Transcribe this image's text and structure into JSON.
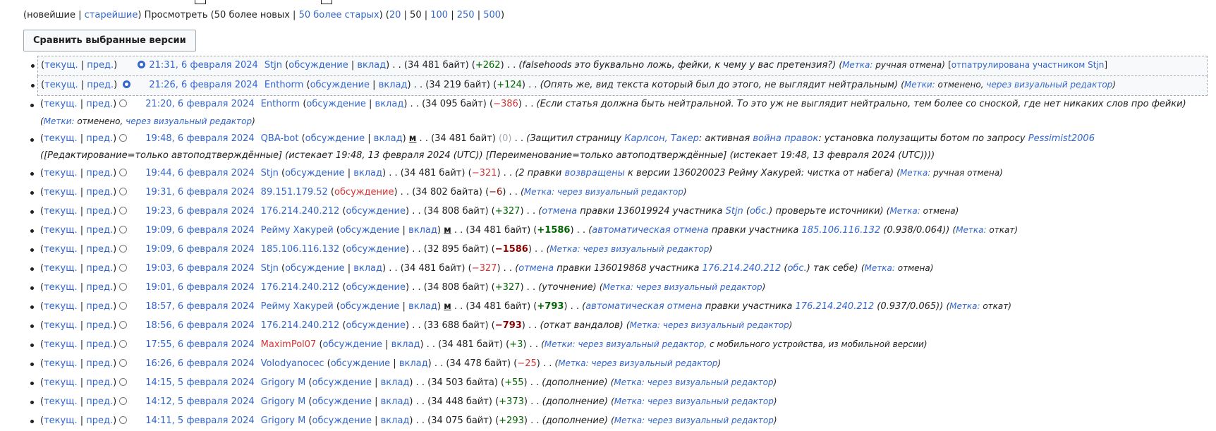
{
  "nav": {
    "newest": "новейшие",
    "oldest": "старейшие",
    "view": "Просмотреть",
    "newer50": "50 более новых",
    "older50": "50 более старых",
    "limits": [
      "20",
      "50",
      "100",
      "250",
      "500"
    ]
  },
  "compare_button": "Сравнить выбранные версии",
  "labels": {
    "cur": "текущ.",
    "prev": "пред.",
    "talk": "обсуждение",
    "contribs": "вклад",
    "talk_short": "обс.",
    "tag": "Метка:",
    "tags": "Метки:",
    "minor": "м",
    "patrolled_by": "отпатрулирована участником"
  },
  "revisions": [
    {
      "date": "21:31, 6 февраля 2024",
      "user": "Stjn",
      "size": "(34 481 байт)",
      "diff": "+262",
      "comment": "falsehoods это буквально ложь, фейки, к чему у вас претензия?",
      "tag": "ручная отмена",
      "patrolled": "Stjn"
    },
    {
      "date": "21:26, 6 февраля 2024",
      "user": "Enthorm",
      "size": "(34 219 байт)",
      "diff": "+124",
      "comment": "Опять же, вид текста который был до этого, не выглядит нейтральным",
      "tag1": "отменено,",
      "tag2": "через визуальный редактор"
    },
    {
      "date": "21:20, 6 февраля 2024",
      "user": "Enthorm",
      "size": "(34 095 байт)",
      "diff": "−386",
      "comment": "Если статья должна быть нейтральной. То это уж не выглядит нейтрально, тем более со сноской, где нет никаких слов про фейки",
      "tag1": "отменено,",
      "tag2": "через визуальный редактор"
    },
    {
      "date": "19:48, 6 февраля 2024",
      "user": "QBA-bot",
      "size": "(34 481 байт)",
      "diff": "0",
      "c1": "Защитил страницу",
      "l1": "Карлсон, Такер",
      "c2": ": активная",
      "l2": "война правок",
      "c3": ": установка полузащиты ботом по запросу",
      "l3": "Pessimist2006",
      "c4": "([Редактирование=только автоподтверждённые] (истекает 19:48, 13 февраля 2024 (UTC)) [Переименование=только автоподтверждённые] (истекает 19:48, 13 февраля 2024 (UTC)))"
    },
    {
      "date": "19:44, 6 февраля 2024",
      "user": "Stjn",
      "size": "(34 481 байт)",
      "diff": "−321",
      "c1": "(2 правки",
      "l1": "возвращены",
      "c2": "к версии 136020023 Рейму Хакурей: чистка от набега)",
      "tag": "ручная отмена"
    },
    {
      "date": "19:31, 6 февраля 2024",
      "user": "89.151.179.52",
      "size": "(34 802 байта)",
      "diff": "−6",
      "tag": "через визуальный редактор"
    },
    {
      "date": "19:23, 6 февраля 2024",
      "user": "176.214.240.212",
      "size": "(34 808 байт)",
      "diff": "+327",
      "l1": "отмена",
      "c1": "правки 136019924 участника",
      "l2": "Stjn",
      "c2": "проверьте источники)",
      "tag": "отмена"
    },
    {
      "date": "19:09, 6 февраля 2024",
      "user": "Рейму Хакурей",
      "size": "(34 481 байт)",
      "diff": "+1586",
      "l1": "автоматическая отмена",
      "c1": "правки участника",
      "l2": "185.106.116.132",
      "c2": "(0.938/0.064))",
      "tag": "откат"
    },
    {
      "date": "19:09, 6 февраля 2024",
      "user": "185.106.116.132",
      "size": "(32 895 байт)",
      "diff": "−1586",
      "tag": "через визуальный редактор"
    },
    {
      "date": "19:03, 6 февраля 2024",
      "user": "Stjn",
      "size": "(34 481 байт)",
      "diff": "−327",
      "l1": "отмена",
      "c1": "правки 136019868 участника",
      "l2": "176.214.240.212",
      "c2": "так себе)",
      "tag": "отмена"
    },
    {
      "date": "19:01, 6 февраля 2024",
      "user": "176.214.240.212",
      "size": "(34 808 байт)",
      "diff": "+327",
      "comment": "уточнение",
      "tag": "через визуальный редактор"
    },
    {
      "date": "18:57, 6 февраля 2024",
      "user": "Рейму Хакурей",
      "size": "(34 481 байт)",
      "diff": "+793",
      "l1": "автоматическая отмена",
      "c1": "правки участника",
      "l2": "176.214.240.212",
      "c2": "(0.937/0.065))",
      "tag": "откат"
    },
    {
      "date": "18:56, 6 февраля 2024",
      "user": "176.214.240.212",
      "size": "(33 688 байт)",
      "diff": "−793",
      "comment": "откат вандалов",
      "tag": "через визуальный редактор"
    },
    {
      "date": "17:55, 6 февраля 2024",
      "user": "MaximPol07",
      "size": "(34 481 байт)",
      "diff": "+3",
      "tag1": "через визуальный редактор,",
      "tag2": "с мобильного устройства, из мобильной версии"
    },
    {
      "date": "16:26, 6 февраля 2024",
      "user": "Volodyanocec",
      "size": "(34 478 байт)",
      "diff": "−25",
      "tag": "через визуальный редактор"
    },
    {
      "date": "14:15, 5 февраля 2024",
      "user": "Grigory M",
      "size": "(34 503 байта)",
      "diff": "+55",
      "comment": "дополнение",
      "tag": "через визуальный редактор"
    },
    {
      "date": "14:12, 5 февраля 2024",
      "user": "Grigory M",
      "size": "(34 448 байт)",
      "diff": "+373",
      "comment": "дополнение",
      "tag": "через визуальный редактор"
    },
    {
      "date": "14:11, 5 февраля 2024",
      "user": "Grigory M",
      "size": "(34 075 байт)",
      "diff": "+293",
      "comment": "дополнение",
      "tag": "через визуальный редактор"
    }
  ]
}
